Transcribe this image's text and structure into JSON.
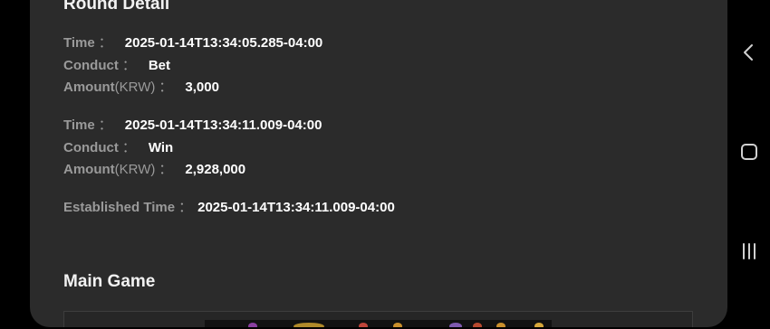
{
  "round_detail": {
    "title": "Round Detail",
    "entries": [
      {
        "time_label": "Time",
        "time_value": "2025-01-14T13:34:05.285-04:00",
        "conduct_label": "Conduct",
        "conduct_value": "Bet",
        "amount_label": "Amount",
        "amount_unit": "(KRW)",
        "amount_value": "3,000"
      },
      {
        "time_label": "Time",
        "time_value": "2025-01-14T13:34:11.009-04:00",
        "conduct_label": "Conduct",
        "conduct_value": "Win",
        "amount_label": "Amount",
        "amount_unit": "(KRW)",
        "amount_value": "2,928,000"
      }
    ],
    "established_label": "Established Time",
    "established_value": "2025-01-14T13:34:11.009-04:00",
    "colon": "："
  },
  "main_game": {
    "title": "Main Game"
  },
  "nav": {
    "icons": [
      "back-icon",
      "home-icon",
      "recents-icon"
    ]
  },
  "colors": {
    "panel_bg": "#2b2b2b",
    "label": "#9a9a9a",
    "value": "#ffffff",
    "nav_icon": "#d0d0d0"
  }
}
